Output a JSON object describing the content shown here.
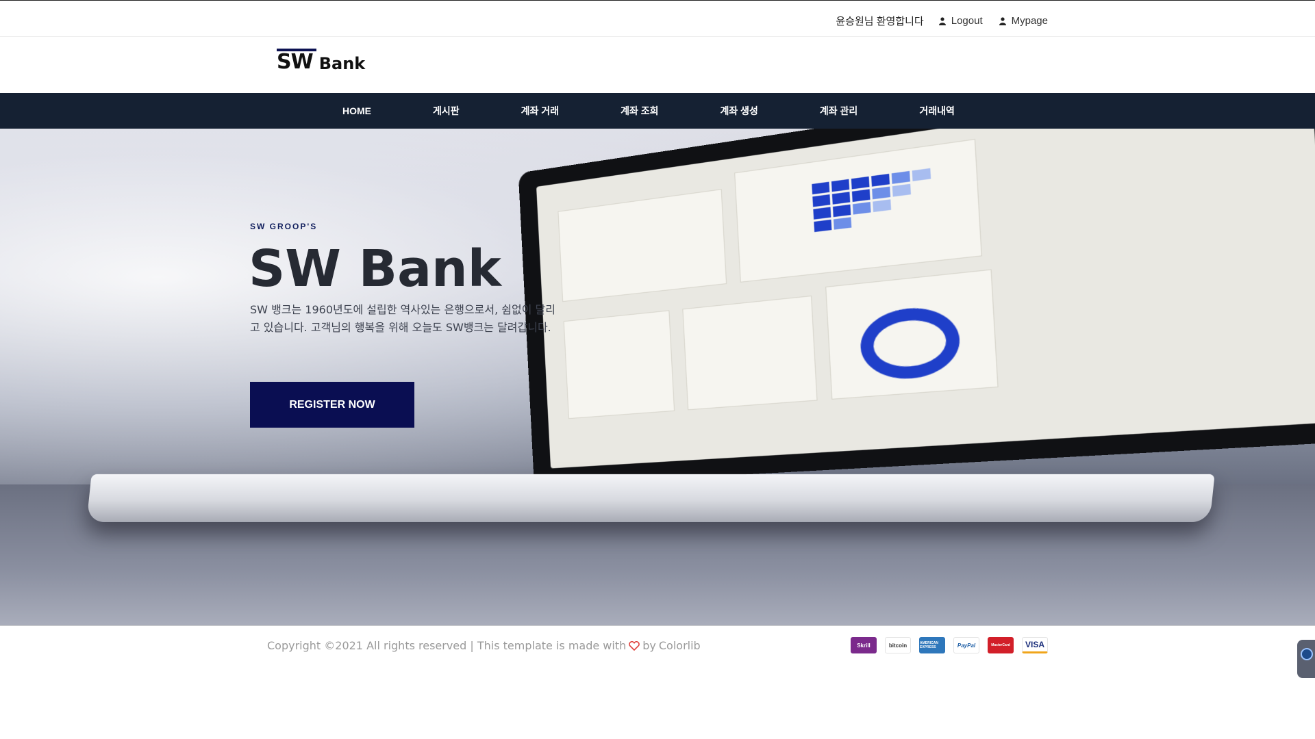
{
  "topbar": {
    "welcome": "윤승원님 환영합니다",
    "logout": "Logout",
    "mypage": "Mypage"
  },
  "logo": {
    "sw": "SW",
    "bank": "Bank"
  },
  "nav": {
    "items": [
      {
        "label": "HOME"
      },
      {
        "label": "게시판"
      },
      {
        "label": "계좌 거래"
      },
      {
        "label": "계좌 조회"
      },
      {
        "label": "계좌 생성"
      },
      {
        "label": "계좌 관리"
      },
      {
        "label": "거래내역"
      }
    ]
  },
  "hero": {
    "eyebrow": "SW GROOP'S",
    "title": "SW Bank",
    "description": "SW 뱅크는 1960년도에 설립한 역사있는 은행으로서, 쉼없이 달리고 있습니다. 고객님의 행복을 위해 오늘도 SW뱅크는 달려갑니다.",
    "cta": "REGISTER NOW"
  },
  "footer": {
    "copyright_prefix": "Copyright ©2021 All rights reserved | This template is made with",
    "copyright_by": "by",
    "colorlib": "Colorlib",
    "payments": [
      "Skrill",
      "bitcoin",
      "AMERICAN EXPRESS",
      "PayPal",
      "MasterCard",
      "VISA"
    ]
  },
  "icons": {
    "user": "user-icon",
    "heart": "heart-icon"
  },
  "colors": {
    "nav_bg": "#152133",
    "cta_bg": "#0a0e52",
    "logo_bar": "#0c1252"
  }
}
